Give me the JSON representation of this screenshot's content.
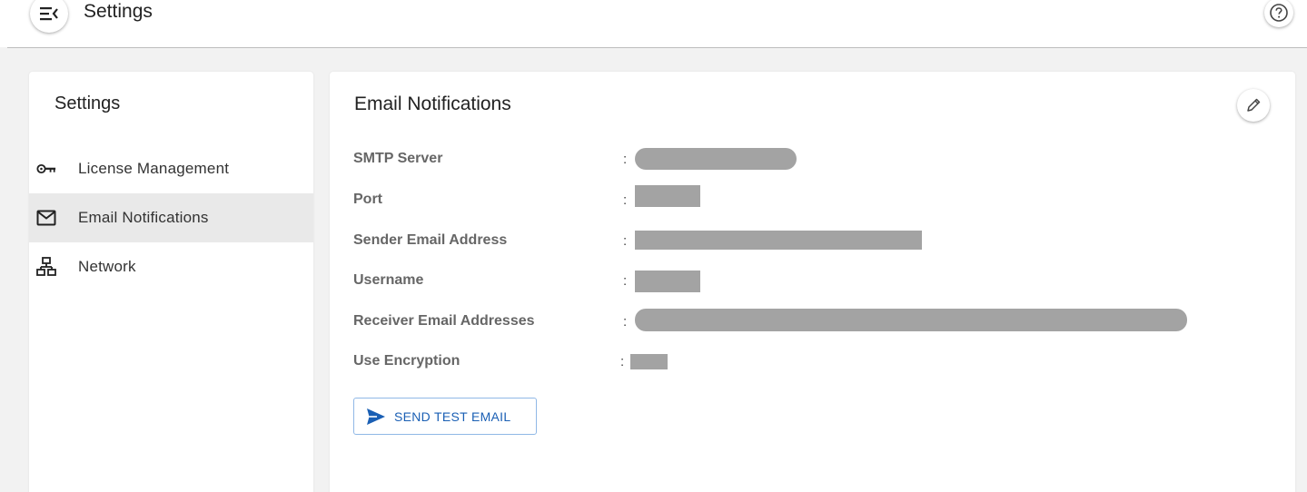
{
  "header": {
    "title": "Settings",
    "menu_icon": "menu-collapse-icon",
    "help_icon": "help-circle-icon"
  },
  "sidebar": {
    "title": "Settings",
    "items": [
      {
        "label": "License Management",
        "icon": "key-icon",
        "active": false
      },
      {
        "label": "Email Notifications",
        "icon": "mail-icon",
        "active": true
      },
      {
        "label": "Network",
        "icon": "network-icon",
        "active": false
      }
    ]
  },
  "main": {
    "title": "Email Notifications",
    "edit_icon": "pencil-icon",
    "colon": ":",
    "fields": [
      {
        "label": "SMTP Server"
      },
      {
        "label": "Port"
      },
      {
        "label": "Sender Email Address"
      },
      {
        "label": "Username"
      },
      {
        "label": "Receiver Email Addresses"
      },
      {
        "label": "Use Encryption"
      }
    ],
    "send_button": {
      "label": "SEND TEST EMAIL",
      "icon": "send-icon"
    }
  },
  "colors": {
    "accent": "#1a5fb4",
    "active_nav_bg": "#e9e9e9",
    "redaction": "#a3a3a3"
  }
}
